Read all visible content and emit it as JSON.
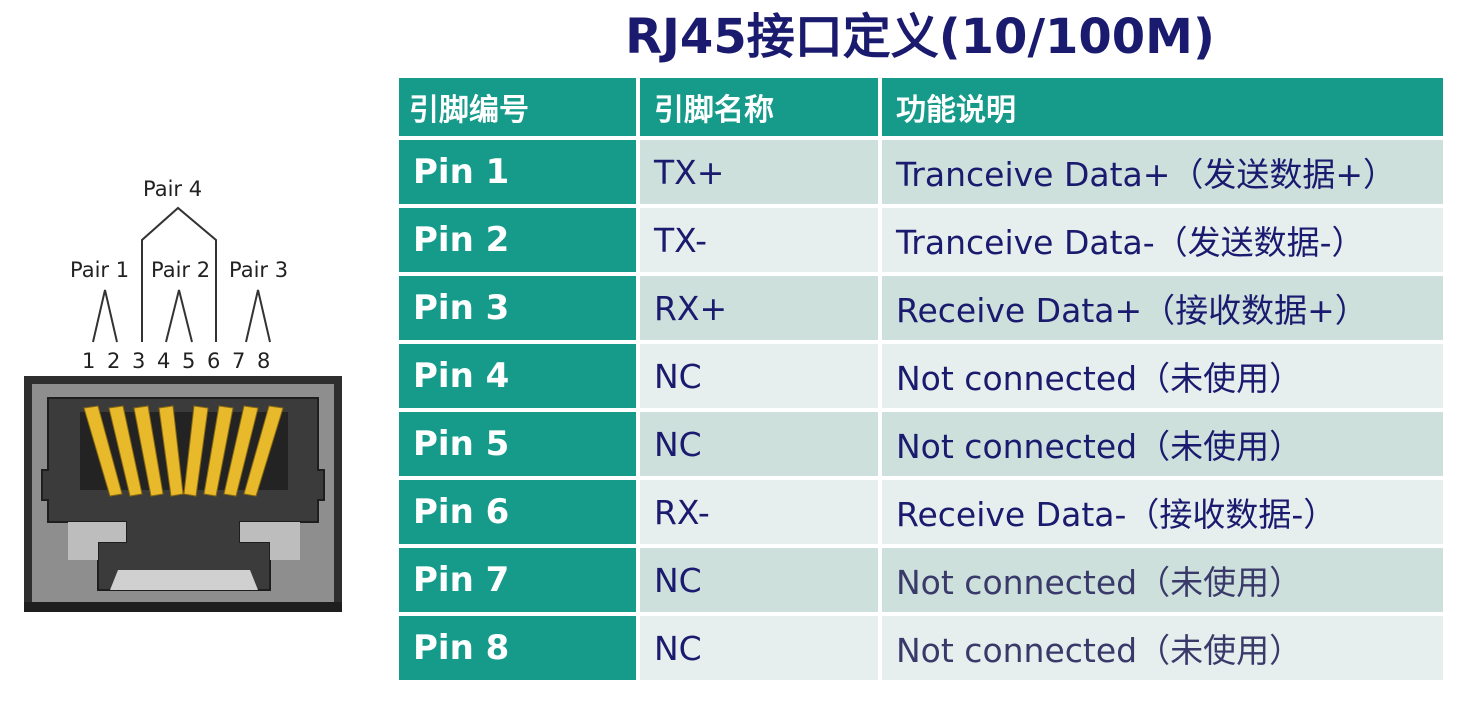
{
  "title": "RJ45接口定义(10/100M)",
  "diagram": {
    "pairs": [
      "Pair 1",
      "Pair 2",
      "Pair 3",
      "Pair 4"
    ],
    "pin_numbers": [
      "1",
      "2",
      "3",
      "4",
      "5",
      "6",
      "7",
      "8"
    ]
  },
  "table": {
    "headers": [
      "引脚编号",
      "引脚名称",
      "功能说明"
    ],
    "rows": [
      {
        "pin": "Pin 1",
        "name": "TX+",
        "desc": "Tranceive Data+（发送数据+）"
      },
      {
        "pin": "Pin 2",
        "name": "TX-",
        "desc": "Tranceive Data-（发送数据-）"
      },
      {
        "pin": "Pin 3",
        "name": "RX+",
        "desc": "Receive Data+（接收数据+）"
      },
      {
        "pin": "Pin 4",
        "name": "NC",
        "desc": "Not connected（未使用）"
      },
      {
        "pin": "Pin 5",
        "name": "NC",
        "desc": "Not connected（未使用）"
      },
      {
        "pin": "Pin 6",
        "name": "RX-",
        "desc": "Receive Data-（接收数据-）"
      },
      {
        "pin": "Pin 7",
        "name": "NC",
        "desc": "Not connected（未使用）"
      },
      {
        "pin": "Pin 8",
        "name": "NC",
        "desc": "Not connected（未使用）"
      }
    ]
  },
  "colors": {
    "header": "#169b8b",
    "title": "#1a1a6e",
    "row_odd": "#cde0dc",
    "row_even": "#e6efed",
    "contact": "#e8b92a",
    "jack_body": "#3a3a3a"
  }
}
